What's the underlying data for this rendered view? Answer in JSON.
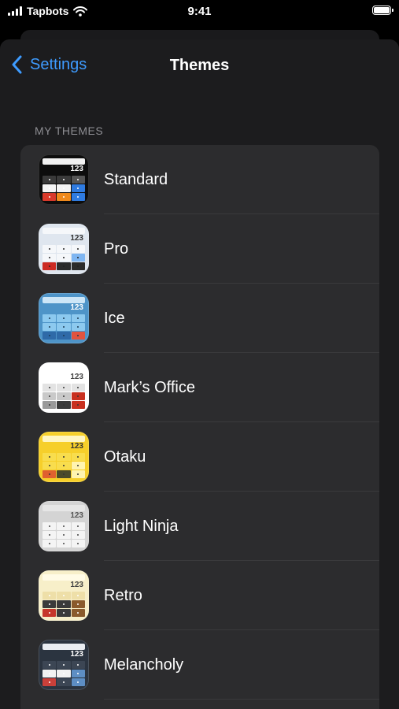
{
  "status_bar": {
    "carrier": "Tapbots",
    "time": "9:41"
  },
  "nav": {
    "back_label": "Settings",
    "title": "Themes"
  },
  "section": {
    "header": "MY THEMES"
  },
  "themes": [
    {
      "name": "Standard",
      "icon_number": "123",
      "colors": {
        "bg": "#0d0d0d",
        "display": "#f2f2f2",
        "number": "#ffffff",
        "dot": "#ffffff",
        "keys": [
          "#3a3a3a",
          "#3a3a3a",
          "#555555",
          "#f5f5f5",
          "#f5f5f5",
          "#2f7be0",
          "#d93a2b",
          "#f08a1c",
          "#2f7be0"
        ]
      }
    },
    {
      "name": "Pro",
      "icon_number": "123",
      "colors": {
        "bg": "#dfe6ef",
        "display": "#f5f7fa",
        "number": "#333333",
        "dot": "#222222",
        "keys": [
          "#f5f7fa",
          "#f5f7fa",
          "#f5f7fa",
          "#f5f7fa",
          "#f5f7fa",
          "#7fb6f2",
          "#cc2a22",
          "#2b2b2b",
          "#2b2b2b"
        ]
      }
    },
    {
      "name": "Ice",
      "icon_number": "123",
      "colors": {
        "bg": "#4e94c8",
        "display": "#cde6f7",
        "number": "#ffffff",
        "dot": "#1b3a55",
        "keys": [
          "#8cc9ef",
          "#8cc9ef",
          "#8cc9ef",
          "#8cc9ef",
          "#8cc9ef",
          "#8cc9ef",
          "#2f6aa8",
          "#2f6aa8",
          "#e2533f"
        ]
      }
    },
    {
      "name": "Mark’s Office",
      "icon_number": "123",
      "colors": {
        "bg": "#ffffff",
        "display": "#ffffff",
        "number": "#444444",
        "dot": "#333333",
        "keys": [
          "#e3e3e3",
          "#e3e3e3",
          "#e3e3e3",
          "#c9c9c9",
          "#c9c9c9",
          "#c9301f",
          "#9a9a9a",
          "#3a3a3a",
          "#c9301f"
        ]
      }
    },
    {
      "name": "Otaku",
      "icon_number": "123",
      "colors": {
        "bg": "#f6cf2a",
        "display": "#fff6c2",
        "number": "#333333",
        "dot": "#333333",
        "keys": [
          "#f8dd4e",
          "#f8dd4e",
          "#f8dd4e",
          "#f8dd4e",
          "#f8dd4e",
          "#fff4b0",
          "#e0612f",
          "#4a4a2a",
          "#fff4b0"
        ]
      }
    },
    {
      "name": "Light Ninja",
      "icon_number": "123",
      "colors": {
        "bg": "#d4d4d4",
        "display": "#e6e6e6",
        "number": "#555555",
        "dot": "#444444",
        "keys": [
          "#f4f4f4",
          "#f4f4f4",
          "#f4f4f4",
          "#f4f4f4",
          "#f4f4f4",
          "#f4f4f4",
          "#f4f4f4",
          "#f4f4f4",
          "#f4f4f4"
        ]
      }
    },
    {
      "name": "Retro",
      "icon_number": "123",
      "colors": {
        "bg": "#f7efc9",
        "display": "#fffbe6",
        "number": "#444444",
        "dot": "#ffffff",
        "keys": [
          "#eedfa8",
          "#eedfa8",
          "#eedfa8",
          "#3a3a3a",
          "#3a3a3a",
          "#8a5a2b",
          "#c5372b",
          "#3a3a3a",
          "#8a5a2b"
        ]
      }
    },
    {
      "name": "Melancholy",
      "icon_number": "123",
      "colors": {
        "bg": "#2b3440",
        "display": "#e9edf2",
        "number": "#ffffff",
        "dot": "#ffffff",
        "keys": [
          "#3c4654",
          "#3c4654",
          "#3c4654",
          "#f2f2f2",
          "#f2f2f2",
          "#5d8ec4",
          "#c9403a",
          "#3c4654",
          "#5d8ec4"
        ]
      }
    }
  ]
}
